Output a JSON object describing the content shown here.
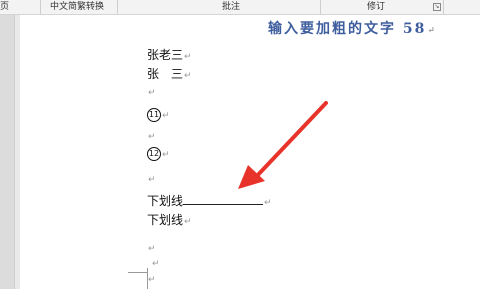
{
  "ribbon": {
    "group_left_partial": "页",
    "group_chinese_conversion": "中文简繁转换",
    "group_comments": "批注",
    "group_track_changes": "修订",
    "expand_glyph": "↘"
  },
  "document": {
    "title": "输入要加粗的文字 58",
    "lines": [
      {
        "text": "张老三"
      },
      {
        "text": "张　三"
      },
      {
        "text": ""
      },
      {
        "circled": "11"
      },
      {
        "text": ""
      },
      {
        "circled": "12"
      },
      {
        "text": ""
      },
      {
        "text": "下划线"
      },
      {
        "text": "下划线"
      },
      {
        "text": ""
      },
      {
        "text": ""
      },
      {
        "text": ""
      }
    ],
    "paragraph_mark": "↵"
  },
  "annotation": {
    "arrow_color": "#e8332b"
  }
}
